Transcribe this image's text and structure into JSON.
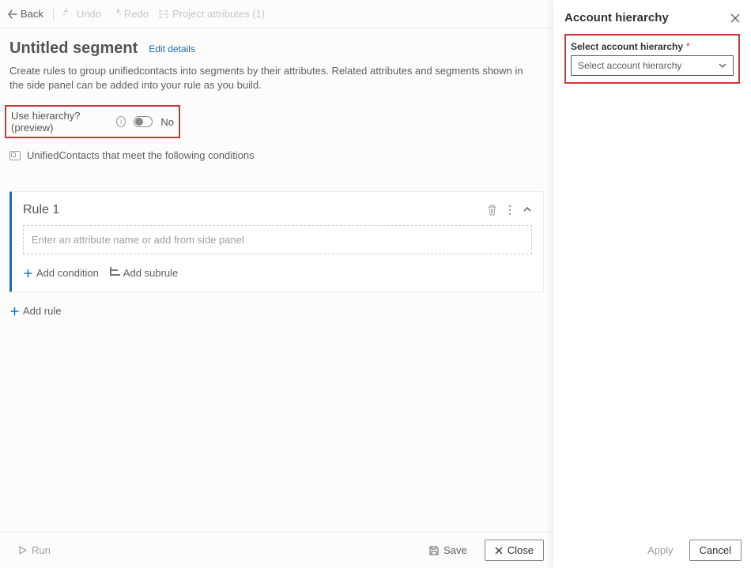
{
  "toolbar": {
    "back": "Back",
    "undo": "Undo",
    "redo": "Redo",
    "project_attributes": "Project attributes (1)"
  },
  "header": {
    "title": "Untitled segment",
    "edit_details": "Edit details",
    "description": "Create rules to group unifiedcontacts into segments by their attributes. Related attributes and segments shown in the side panel can be added into your rule as you build."
  },
  "hierarchy": {
    "label": "Use hierarchy? (preview)",
    "value_text": "No"
  },
  "conditions_text": "UnifiedContacts that meet the following conditions",
  "rule": {
    "name": "Rule 1",
    "attr_placeholder": "Enter an attribute name or add from side panel",
    "add_condition": "Add condition",
    "add_subrule": "Add subrule"
  },
  "add_rule": "Add rule",
  "footer": {
    "run": "Run",
    "save": "Save",
    "close": "Close"
  },
  "side_panel": {
    "title": "Account hierarchy",
    "select_label": "Select account hierarchy",
    "select_value": "Select account hierarchy",
    "apply": "Apply",
    "cancel": "Cancel"
  }
}
